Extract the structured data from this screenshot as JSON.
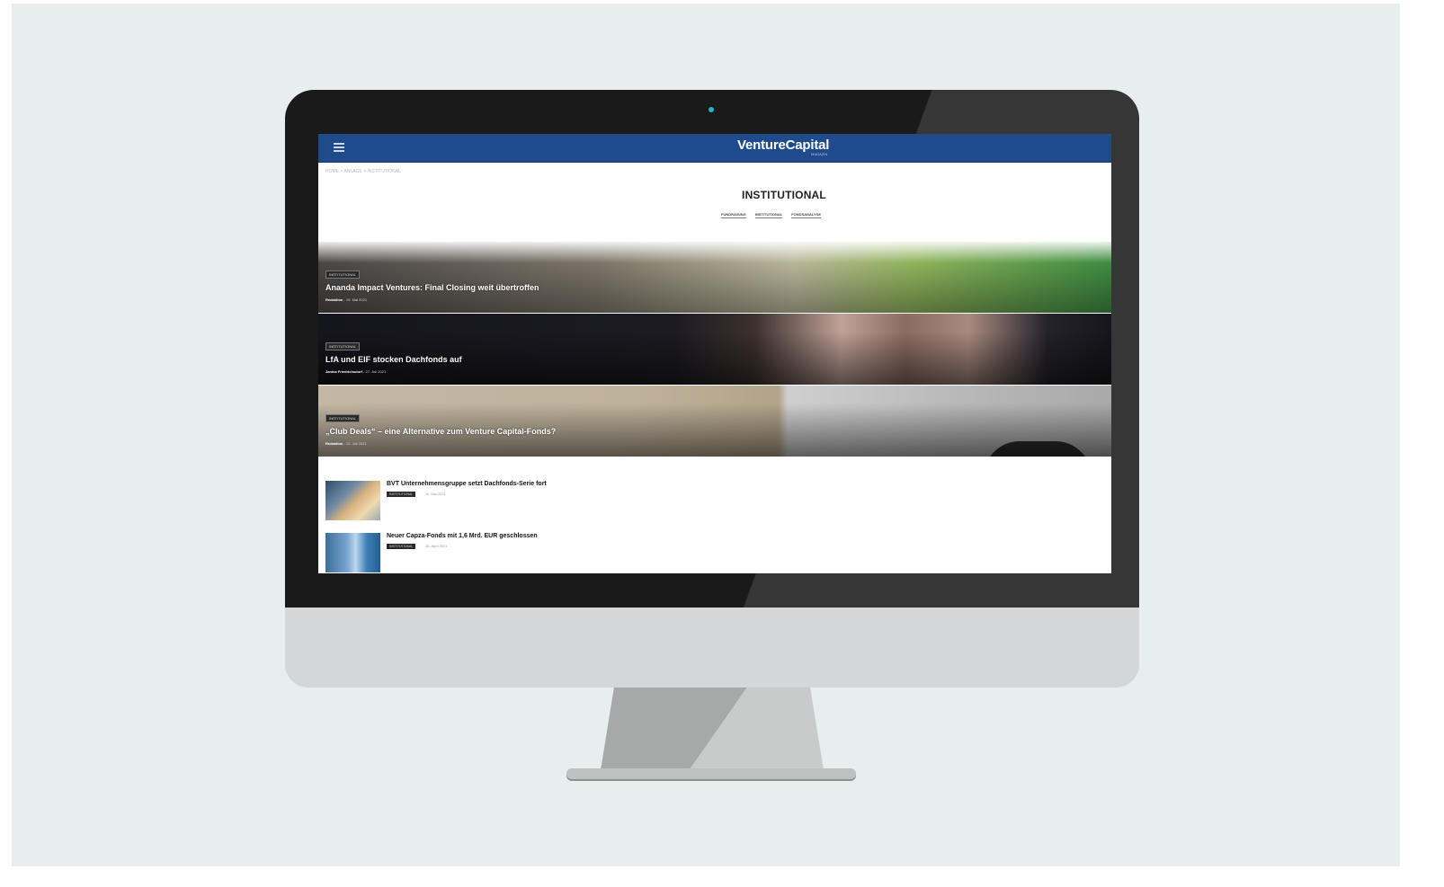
{
  "site": {
    "logo": "VentureCapital",
    "logo_sub": "MAGAZIN"
  },
  "breadcrumb": "HOME  >  ANLAGE  >  INSTITUTIONAL",
  "page_title": "INSTITUTIONAL",
  "subtabs": [
    "FUNDRAISING",
    "INSTITUTIONAL",
    "FONDSANALYSE"
  ],
  "heroes": [
    {
      "tag": "INSTITUTIONAL",
      "title": "Ananda Impact Ventures: Final Closing weit übertroffen",
      "author": "Redaktion",
      "date": "19. Mai 2021"
    },
    {
      "tag": "INSTITUTIONAL",
      "title": "LfA und EIF stocken Dachfonds auf",
      "author": "Janina Friedrichsdorf",
      "date": "27. Juli 2021"
    },
    {
      "tag": "INSTITUTIONAL",
      "title": "„Club Deals“ – eine Alternative zum Venture Capital-Fonds?",
      "author": "Redaktion",
      "date": "12. Juli 2021"
    }
  ],
  "list": [
    {
      "title": "BVT Unternehmensgruppe setzt Dachfonds-Serie fort",
      "tag": "INSTITUTIONAL",
      "date": "11. Mai 2021"
    },
    {
      "title": "Neuer Capza-Fonds mit 1,6 Mrd. EUR geschlossen",
      "tag": "INSTITUTIONAL",
      "date": "28. April 2021"
    }
  ]
}
